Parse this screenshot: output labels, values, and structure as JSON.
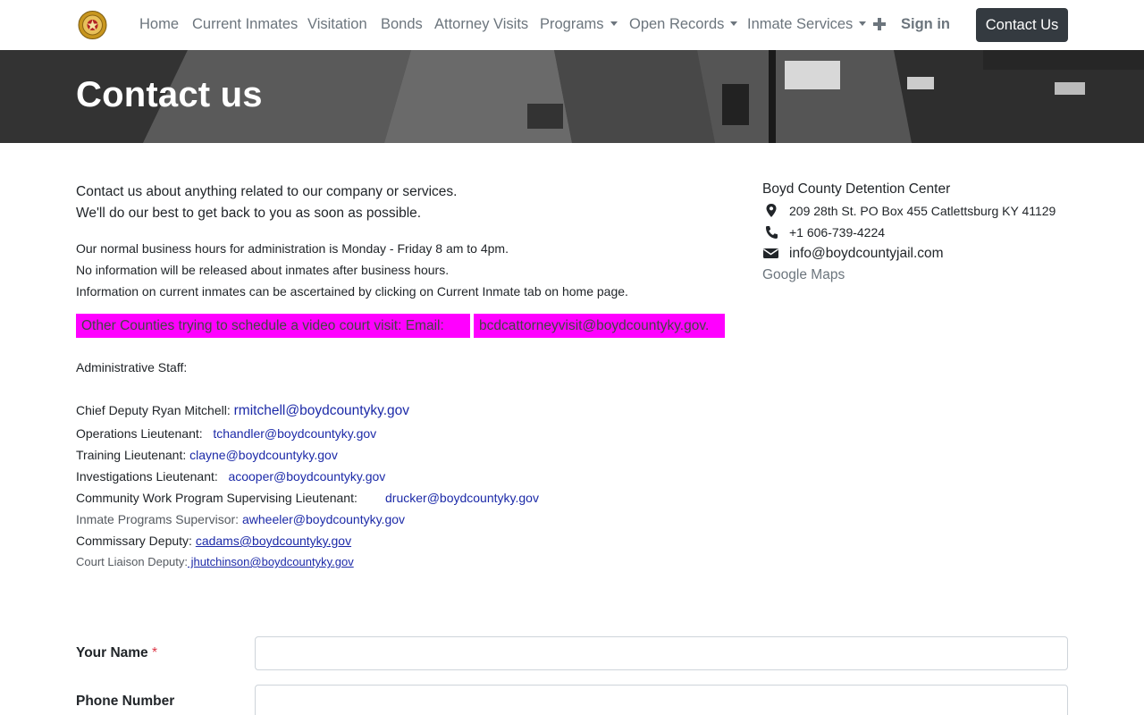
{
  "nav": {
    "items": [
      {
        "label": "Home"
      },
      {
        "label": "Current Inmates"
      },
      {
        "label": "Visitation"
      },
      {
        "label": "Bonds"
      },
      {
        "label": "Attorney Visits"
      },
      {
        "label": "Programs"
      },
      {
        "label": "Open Records"
      },
      {
        "label": "Inmate Services"
      }
    ],
    "signin": "Sign in",
    "contact_button": "Contact Us"
  },
  "banner": {
    "title": "Contact us"
  },
  "intro": {
    "line1": "Contact us about anything related to our company or services.",
    "line2": "We'll do our best to get back to you as soon as possible."
  },
  "hours": {
    "line1": "Our normal business hours for administration is Monday - Friday 8 am to 4pm.",
    "line2": "No information will be released about inmates after business hours.",
    "line3": "Information on current inmates can be ascertained by clicking on Current Inmate tab on home page."
  },
  "highlight": {
    "text": "Other Counties trying to schedule a video court visit:  Email:",
    "email": "bcdcattorneyvisit@boydcountyky.gov."
  },
  "staff": {
    "heading": "Administrative Staff:",
    "rows": [
      {
        "title": "Chief Deputy  Ryan Mitchell:",
        "email": "rmitchell@boydcountyky.gov"
      },
      {
        "title": "Operations Lieutenant:",
        "email": "tchandler@boydcountyky.gov"
      },
      {
        "title": "Training Lieutenant:",
        "email": "clayne@boydcountyky.gov"
      },
      {
        "title": "Investigations Lieutenant:",
        "email": "acooper@boydcountyky.gov"
      },
      {
        "title": "Community Work Program Supervising Lieutenant:",
        "email": "drucker@boydcountyky.gov"
      },
      {
        "title": "Inmate Programs Supervisor:",
        "email": "awheeler@boydcountyky.gov"
      },
      {
        "title": "Commissary Deputy:",
        "email": "cadams@boydcountyky.gov"
      },
      {
        "title": "Court Liaison Deputy:",
        "email": " jhutchinson@boydcountyky.gov"
      }
    ]
  },
  "contact_info": {
    "name": "Boyd County Detention Center",
    "address": "209 28th St. PO Box 455 Catlettsburg KY 41129",
    "phone": "+1  606-739-4224",
    "email": "info@boydcountyjail.com",
    "maps_link": "Google Maps"
  },
  "form": {
    "name_label": "Your Name",
    "required_mark": "*",
    "phone_label": "Phone Number"
  },
  "icons": {
    "logo": "badge-logo",
    "plus": "plus-icon",
    "location": "map-marker-icon",
    "phone": "phone-icon",
    "email": "envelope-icon"
  }
}
